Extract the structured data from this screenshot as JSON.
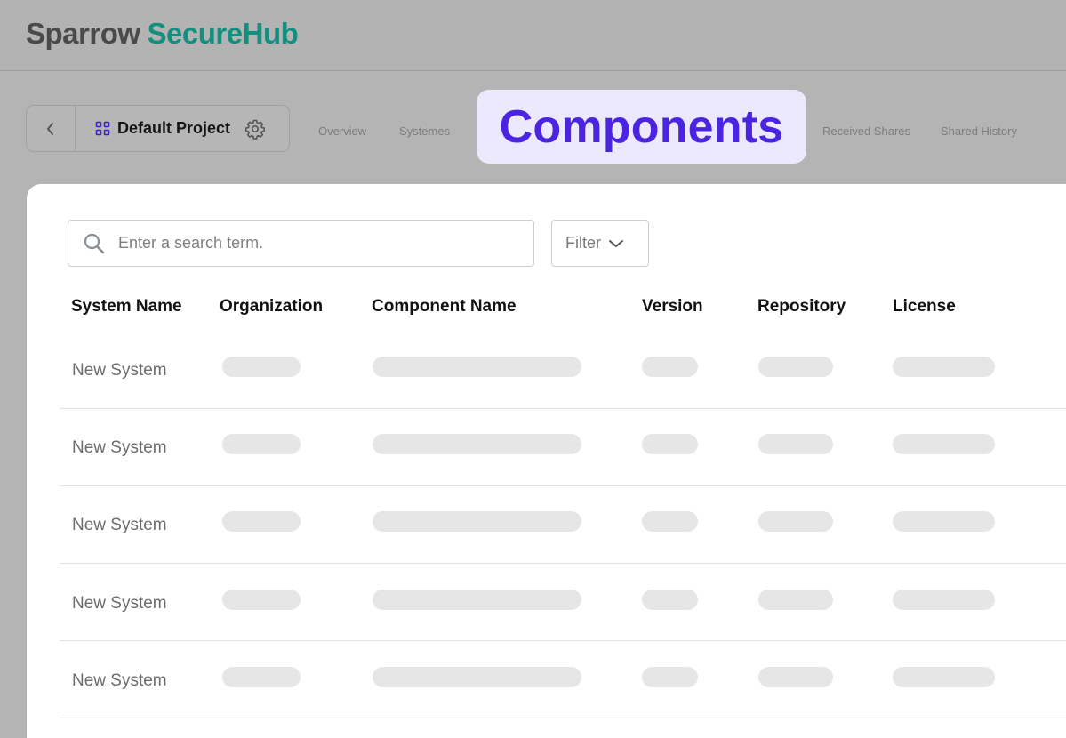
{
  "header": {
    "logo_part1": "Sparrow",
    "logo_part2": "SecureHub"
  },
  "project": {
    "name": "Default Project"
  },
  "tabs": {
    "overview": "Overview",
    "systemes": "Systemes",
    "components": "Components",
    "received_shares": "Received Shares",
    "shared_history": "Shared History"
  },
  "toolbar": {
    "search_placeholder": "Enter a search term.",
    "filter_label": "Filter"
  },
  "table": {
    "columns": [
      "System Name",
      "Organization",
      "Component Name",
      "Version",
      "Repository",
      "License"
    ],
    "rows": [
      {
        "system_name": "New System"
      },
      {
        "system_name": "New System"
      },
      {
        "system_name": "New System"
      },
      {
        "system_name": "New System"
      },
      {
        "system_name": "New System"
      }
    ]
  },
  "colors": {
    "brand_gray": "#4a4a4a",
    "brand_teal": "#11907f",
    "accent": "#4a24e0",
    "accent_bg": "#ebe9fb"
  },
  "icons": [
    "chevron-left-icon",
    "grid-icon",
    "gear-icon",
    "search-icon",
    "chevron-down-icon"
  ]
}
